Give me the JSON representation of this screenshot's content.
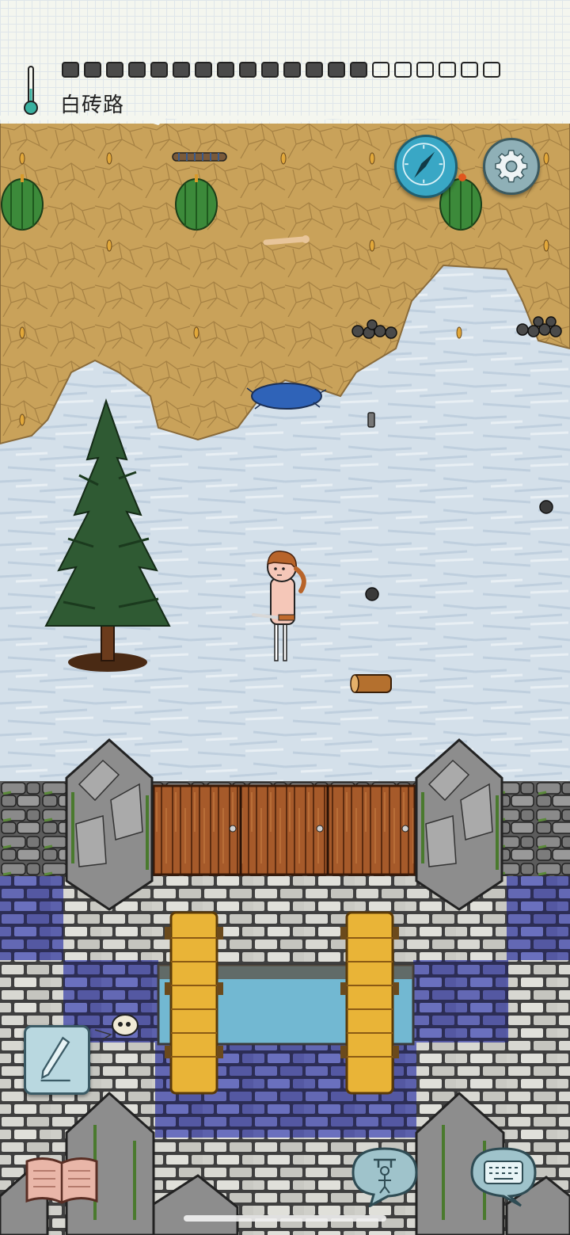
{
  "hud": {
    "biome_label": "白砖路",
    "food_pips": {
      "filled": 14,
      "total": 20
    }
  },
  "colors": {
    "desert": "#caa358",
    "snow": "#d3dfea",
    "stone_wall": "#6e6e6e",
    "wood_gate": "#9a5428",
    "white_brick": "#cfcfc9",
    "blue_brick": "#5a5fa8",
    "water": "#6fb6cf",
    "plank": "#e9b437",
    "compass": "#39a7c5",
    "gear": "#8fb0b7"
  },
  "icons": {
    "compass": "compass-icon",
    "settings": "gear-icon",
    "note": "pencil-icon",
    "recipe_book": "book-icon",
    "emote": "puppet-icon",
    "keyboard": "keyboard-icon"
  }
}
